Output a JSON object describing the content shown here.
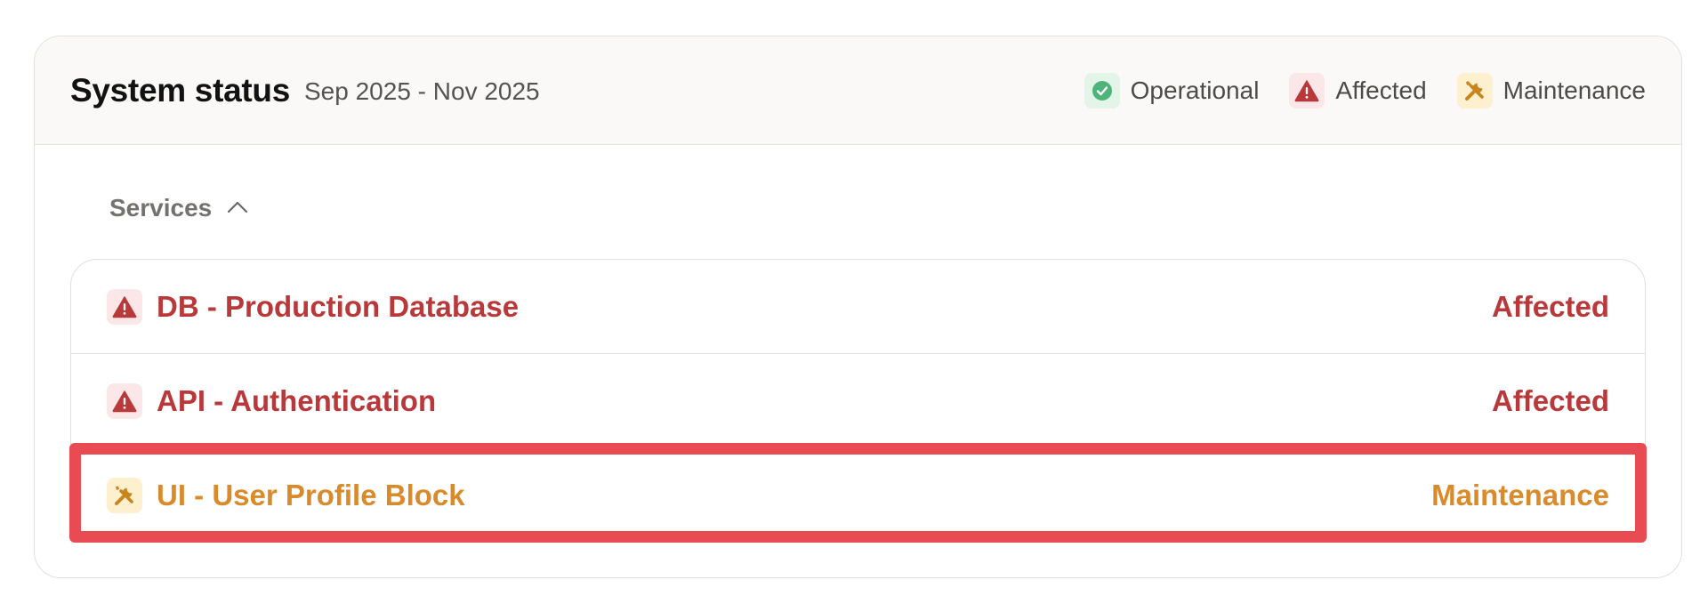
{
  "header": {
    "title": "System status",
    "date_range": "Sep 2025 - Nov 2025"
  },
  "legend": {
    "operational": {
      "label": "Operational",
      "icon": "check-circle-icon",
      "color": "#4fb47a"
    },
    "affected": {
      "label": "Affected",
      "icon": "warning-triangle-icon",
      "color": "#b9383a"
    },
    "maintenance": {
      "label": "Maintenance",
      "icon": "wrench-screwdriver-icon",
      "color": "#d98b2c"
    }
  },
  "services": {
    "toggle_label": "Services",
    "toggle_icon": "chevron-up-icon",
    "items": [
      {
        "name": "DB - Production Database",
        "status": "Affected",
        "icon": "warning-triangle-icon",
        "color": "#b9383a"
      },
      {
        "name": "API - Authentication",
        "status": "Affected",
        "icon": "warning-triangle-icon",
        "color": "#b9383a"
      },
      {
        "name": "UI - User Profile Block",
        "status": "Maintenance",
        "icon": "wrench-screwdriver-icon",
        "color": "#d98b2c"
      }
    ]
  },
  "colors": {
    "highlight": "#e84c52"
  }
}
